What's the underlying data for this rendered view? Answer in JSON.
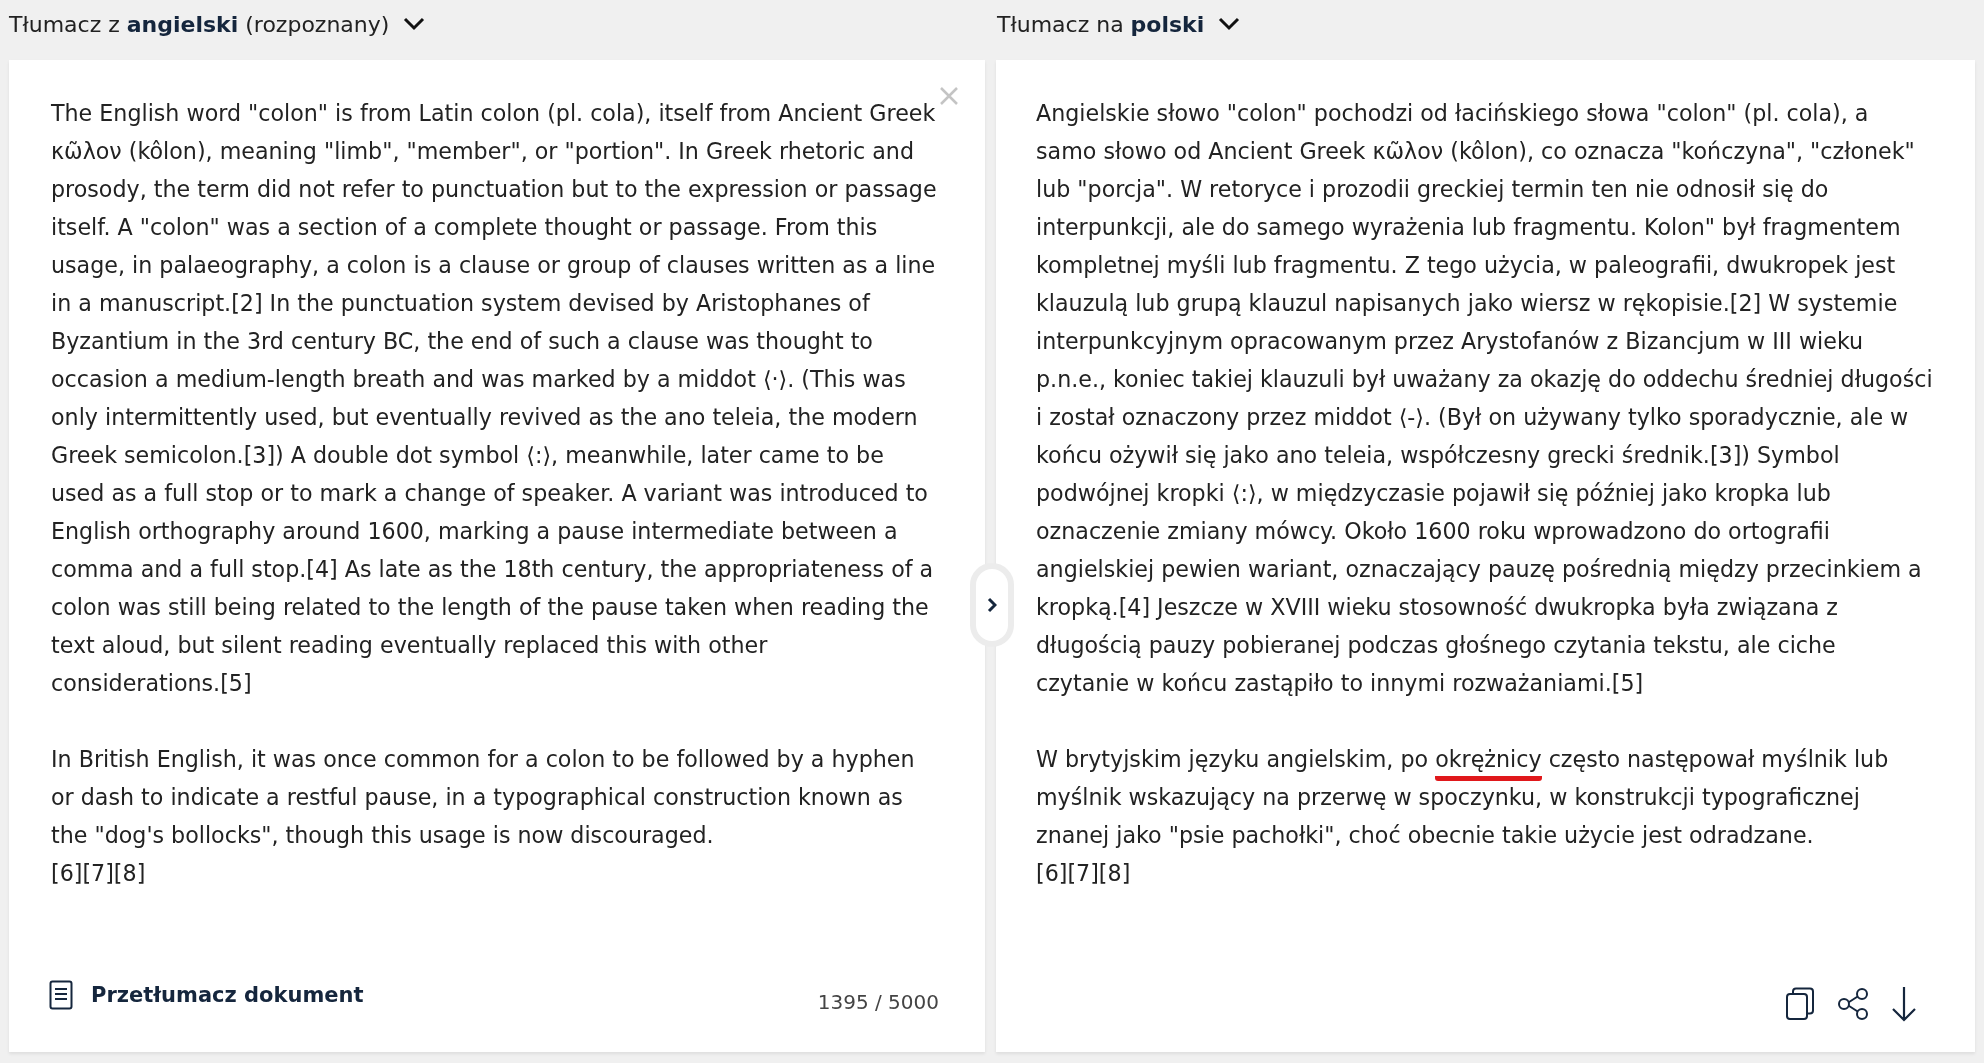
{
  "source_language": {
    "label": "Tłumacz z **angielski** (rozpoznany)"
  },
  "target_language": {
    "label": "Tłumacz na **polski**"
  },
  "source_text": {
    "paragraphs": [
      [
        {
          "text": "The English word \"colon\" is from Latin colon (pl. cola), itself from Ancient Greek κῶλον (kôlon), meaning \"limb\", \"member\", or \"portion\". In Greek rhetoric and prosody, the term did not refer to punctuation but to the expression or passage itself. A \"colon\" was a section of a complete thought or passage. From this usage, in palaeography, a colon is a clause or group of clauses written as a line in a manuscript.[2] In the punctuation system devised by Aristophanes of Byzantium in the 3rd century BC, the end of such a clause was thought to occasion a medium-length breath and was marked by a middot ⟨·⟩. (This was only intermittently used, but eventually revived as the ano teleia, the modern Greek semicolon.[3]) A double dot symbol ⟨:⟩, meanwhile, later came to be used as a full stop or to mark a change of speaker. A variant was introduced to English orthography around 1600, marking a pause intermediate between a comma and a full stop.[4] As late as the 18th century, the appropriateness of a colon was still being related to the length of the pause taken when reading the text aloud, but silent reading eventually replaced this with other considerations.[5]",
          "misspelled": false
        }
      ],
      [
        {
          "text": "In British English, it was once common for a colon to be followed by a hyphen or dash to indicate a restful pause, in a typographical construction known as the \"dog's bollocks\", though this usage is now discouraged.\n[6][7][8]",
          "misspelled": false
        }
      ]
    ]
  },
  "translate_document_button": {
    "label": "Przetłumacz dokument"
  },
  "char_count": "1395 / 5000",
  "translated_text": {
    "paragraphs": [
      [
        {
          "text": "Angielskie słowo \"colon\" pochodzi od łacińskiego słowa \"colon\" (pl. cola), a samo słowo od Ancient Greek κῶλον (kôlon), co oznacza \"kończyna\", \"członek\" lub \"porcja\". W retoryce i prozodii greckiej termin ten nie odnosił się do interpunkcji, ale do samego wyrażenia lub fragmentu. Kolon\" był fragmentem kompletnej myśli lub fragmentu. Z tego użycia, w paleografii, dwukropek jest klauzulą lub grupą klauzul napisanych jako wiersz w rękopisie.[2] W systemie interpunkcyjnym opracowanym przez Arystofanów z Bizancjum w III wieku p.n.e., koniec takiej klauzuli był uważany za okazję do oddechu średniej długości i został oznaczony przez middot ⟨-⟩. (Był on używany tylko sporadycznie, ale w końcu ożywił się jako ano teleia, współczesny grecki średnik.[3]) Symbol podwójnej kropki ⟨:⟩, w międzyczasie pojawił się później jako kropka lub oznaczenie zmiany mówcy. Około 1600 roku wprowadzono do ortografii angielskiej pewien wariant, oznaczający pauzę pośrednią między przecinkiem a kropką.[4] Jeszcze w XVIII wieku stosowność dwukropka była związana z długością pauzy pobieranej podczas głośnego czytania tekstu, ale ciche czytanie w końcu zastąpiło to innymi rozważaniami.[5]",
          "misspelled": false
        }
      ],
      [
        {
          "text": "W brytyjskim języku angielskim, po ",
          "misspelled": false
        },
        {
          "text": "okrężnicy",
          "misspelled": true
        },
        {
          "text": " często następował myślnik lub myślnik wskazujący na przerwę w spoczynku, w konstrukcji typograficznej znanej jako \"psie pachołki\", choć obecnie takie użycie jest odradzane.\n[6][7][8]",
          "misspelled": false
        }
      ]
    ]
  }
}
